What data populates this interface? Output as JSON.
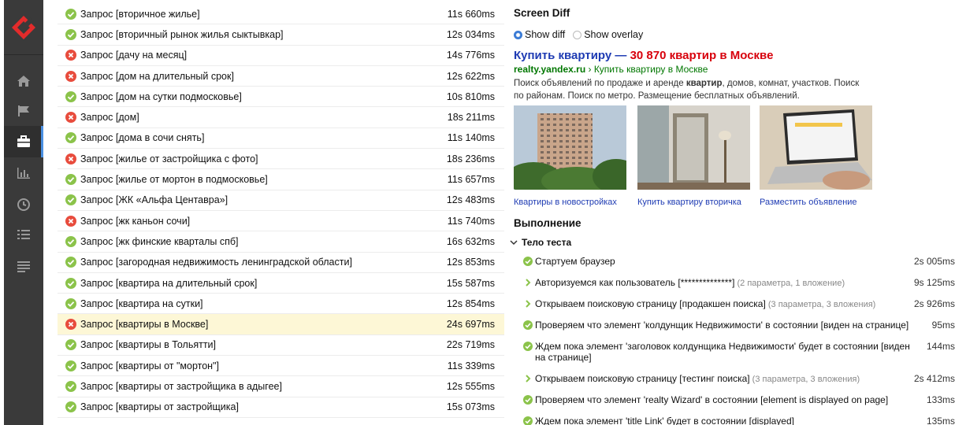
{
  "nav": {
    "items": [
      {
        "icon": "home-icon"
      },
      {
        "icon": "flag-icon"
      },
      {
        "icon": "briefcase-icon",
        "active": true
      },
      {
        "icon": "bar-chart-icon"
      },
      {
        "icon": "clock-icon"
      },
      {
        "icon": "list-icon"
      },
      {
        "icon": "lines-icon"
      }
    ]
  },
  "tests": [
    {
      "name": "Запрос [вторичное жилье]",
      "duration": "11s 660ms",
      "status": "passed"
    },
    {
      "name": "Запрос [вторичный рынок жилья сыктывкар]",
      "duration": "12s 034ms",
      "status": "passed"
    },
    {
      "name": "Запрос [дачу на месяц]",
      "duration": "14s 776ms",
      "status": "failed"
    },
    {
      "name": "Запрос [дом на длительный срок]",
      "duration": "12s 622ms",
      "status": "failed"
    },
    {
      "name": "Запрос [дом на сутки подмосковье]",
      "duration": "10s 810ms",
      "status": "passed"
    },
    {
      "name": "Запрос [дом]",
      "duration": "18s 211ms",
      "status": "failed"
    },
    {
      "name": "Запрос [дома в сочи снять]",
      "duration": "11s 140ms",
      "status": "passed"
    },
    {
      "name": "Запрос [жилье от застройщика с фото]",
      "duration": "18s 236ms",
      "status": "failed"
    },
    {
      "name": "Запрос [жилье от мортон в подмосковье]",
      "duration": "11s 657ms",
      "status": "passed"
    },
    {
      "name": "Запрос [ЖК «Альфа Центавра»]",
      "duration": "12s 483ms",
      "status": "passed"
    },
    {
      "name": "Запрос [жк каньон сочи]",
      "duration": "11s 740ms",
      "status": "failed"
    },
    {
      "name": "Запрос [жк финские кварталы спб]",
      "duration": "16s 632ms",
      "status": "passed"
    },
    {
      "name": "Запрос [загородная недвижимость ленинградской области]",
      "duration": "12s 853ms",
      "status": "passed"
    },
    {
      "name": "Запрос [квартира на длительный срок]",
      "duration": "15s 587ms",
      "status": "passed"
    },
    {
      "name": "Запрос [квартира на сутки]",
      "duration": "12s 854ms",
      "status": "passed"
    },
    {
      "name": "Запрос [квартиры в Москве]",
      "duration": "24s 697ms",
      "status": "failed",
      "selected": true
    },
    {
      "name": "Запрос [квартиры в Тольятти]",
      "duration": "22s 719ms",
      "status": "passed"
    },
    {
      "name": "Запрос [квартиры от \"мортон\"]",
      "duration": "11s 339ms",
      "status": "passed"
    },
    {
      "name": "Запрос [квартиры от застройщика в адыгее]",
      "duration": "12s 555ms",
      "status": "passed"
    },
    {
      "name": "Запрос [квартиры от застройщика]",
      "duration": "15s 073ms",
      "status": "passed"
    }
  ],
  "diff": {
    "title": "Screen Diff",
    "show_diff": "Show diff",
    "show_overlay": "Show overlay",
    "snippet": {
      "title_prefix": "Купить квартиру — ",
      "title_overlap": "30 870 квартир в Москве",
      "url_domain": "realty.yandex.ru",
      "url_path": " › Купить квартиру в Москве",
      "desc_1": "Поиск объявлений по продаже и аренде ",
      "desc_bold": "квартир",
      "desc_2": ", домов, комнат, участков. Поиск по районам. Поиск по метро. Размещение бесплатных объявлений."
    },
    "thumbs": [
      {
        "caption": "Квартиры в новостройках"
      },
      {
        "caption": "Купить квартиру вторичка"
      },
      {
        "caption": "Разместить объявление"
      }
    ]
  },
  "execution": {
    "title": "Выполнение",
    "body_title": "Тело теста",
    "steps": [
      {
        "icon": "check",
        "text": "Стартуем браузер",
        "extra": "",
        "duration": "2s 005ms"
      },
      {
        "icon": "chevron",
        "text": "Авторизуемся как пользователь [**************]",
        "extra": " (2 параметра, 1 вложение)",
        "duration": "9s 125ms"
      },
      {
        "icon": "chevron",
        "text": "Открываем поисковую страницу [продакшен поиска]",
        "extra": " (3 параметра, 3 вложения)",
        "duration": "2s 926ms"
      },
      {
        "icon": "check",
        "text": "Проверяем что элемент 'колдунщик Недвижимости' в состоянии [виден на странице]",
        "extra": "",
        "duration": "95ms"
      },
      {
        "icon": "check",
        "text": "Ждем пока элемент 'заголовок колдунщика Недвижимости' будет в состоянии [виден на странице]",
        "extra": "",
        "duration": "144ms"
      },
      {
        "icon": "chevron",
        "text": "Открываем поисковую страницу [тестинг поиска]",
        "extra": " (3 параметра, 3 вложения)",
        "duration": "2s 412ms"
      },
      {
        "icon": "check",
        "text": "Проверяем что элемент 'realty Wizard' в состоянии [element is displayed on page]",
        "extra": "",
        "duration": "133ms"
      },
      {
        "icon": "check",
        "text": "Ждем пока элемент 'title Link' будет в состоянии [displayed]",
        "extra": "",
        "duration": "135ms"
      }
    ]
  },
  "colors": {
    "passed": "#8bc34a",
    "failed": "#e84c3d",
    "accent": "#4a90e2",
    "sidebar": "#3a3a3a"
  }
}
